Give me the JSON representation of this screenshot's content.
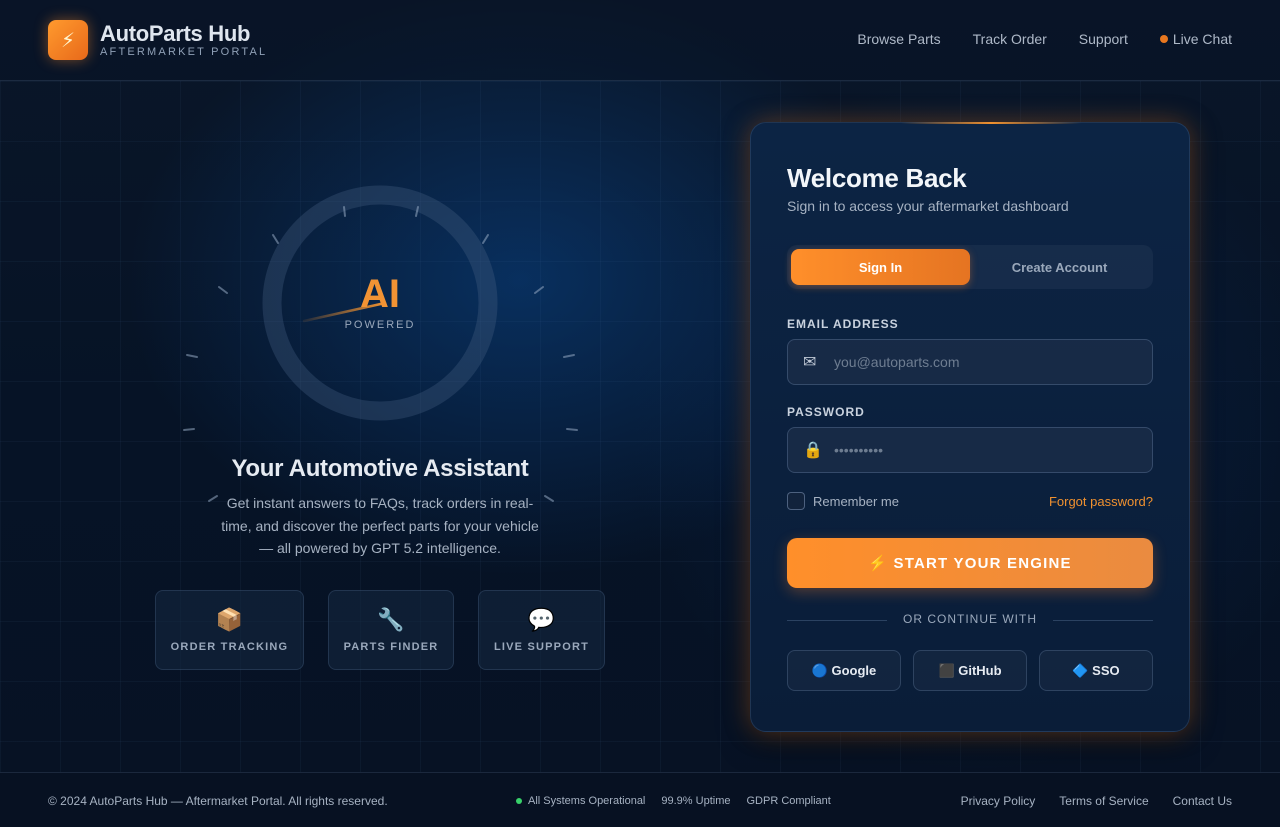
{
  "header": {
    "brand_name": "AutoParts Hub",
    "brand_sub": "AFTERMARKET PORTAL",
    "logo_icon": "lightning-icon",
    "nav": [
      {
        "label": "Browse Parts"
      },
      {
        "label": "Track Order"
      },
      {
        "label": "Support"
      },
      {
        "label": "Live Chat",
        "status_color": "#e8771f"
      }
    ]
  },
  "hero": {
    "badge_title": "AI",
    "badge_sub": "POWERED",
    "title": "Your Automotive Assistant",
    "description": "Get instant answers to FAQs, track orders in real-time, and discover the perfect parts for your vehicle — all powered by GPT 5.2 intelligence.",
    "features": [
      {
        "icon": "📦",
        "icon_name": "package-icon",
        "label": "ORDER TRACKING"
      },
      {
        "icon": "🔧",
        "icon_name": "wrench-icon",
        "label": "PARTS FINDER"
      },
      {
        "icon": "💬",
        "icon_name": "chat-bubble-icon",
        "label": "LIVE SUPPORT"
      }
    ]
  },
  "login": {
    "title": "Welcome Back",
    "subtitle": "Sign in to access your aftermarket dashboard",
    "tabs": [
      {
        "label": "Sign In",
        "active": true
      },
      {
        "label": "Create Account",
        "active": false
      }
    ],
    "email_label": "EMAIL ADDRESS",
    "email_placeholder": "you@autoparts.com",
    "email_icon": "mail-icon",
    "password_label": "PASSWORD",
    "password_placeholder": "••••••••••",
    "password_icon": "lock-icon",
    "remember_label": "Remember me",
    "remember_checked": false,
    "forgot_label": "Forgot password?",
    "submit_label": "⚡ START YOUR ENGINE",
    "divider_label": "OR CONTINUE WITH",
    "social": [
      {
        "label": "🔵 Google"
      },
      {
        "label": "⬛ GitHub"
      },
      {
        "label": "🔷 SSO"
      }
    ],
    "accent_color": "#f0912f"
  },
  "footer": {
    "copyright": "© 2024 AutoParts Hub — Aftermarket Portal. All rights reserved.",
    "status": "All Systems Operational",
    "status_color": "#38d16a",
    "uptime": "99.9% Uptime",
    "compliance": "GDPR Compliant",
    "links": [
      {
        "label": "Privacy Policy"
      },
      {
        "label": "Terms of Service"
      },
      {
        "label": "Contact Us"
      }
    ]
  }
}
